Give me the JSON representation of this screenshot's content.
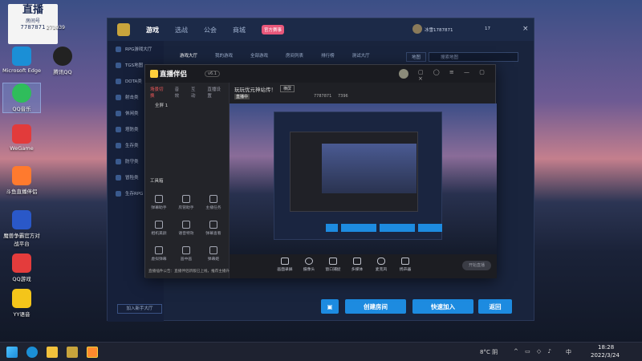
{
  "desktop": {
    "watermark": {
      "title": "直播",
      "sub": "房间号",
      "room": "7787871",
      "extra": "271039"
    },
    "icons": [
      {
        "label": "Microsoft Edge",
        "color": "#1b8fd6",
        "glyph": "e"
      },
      {
        "label": "腾讯QQ",
        "color": "#222",
        "glyph": "Q"
      },
      {
        "label": "QQ音乐",
        "color": "#2fbd5b",
        "glyph": "♪"
      },
      {
        "label": "WeGame",
        "color": "#e23b3b",
        "glyph": "W"
      },
      {
        "label": "斗鱼直播伴侣",
        "color": "#ff7a2e",
        "glyph": "鱼"
      },
      {
        "label": "魔兽争霸官方对战平台",
        "color": "#2a58c8",
        "glyph": "W"
      },
      {
        "label": "QQ游戏",
        "color": "#e43c3c",
        "glyph": "Q"
      },
      {
        "label": "YY语音",
        "color": "#f4c51a",
        "glyph": "YY"
      }
    ]
  },
  "lobby": {
    "nav": [
      "游戏",
      "选战",
      "公会",
      "商城"
    ],
    "badge": "官方赛事",
    "user": "冰雪1787871",
    "level": "17",
    "tabs": [
      "游戏大厅",
      "我的游戏",
      "全部游戏",
      "房间列表",
      "排行榜",
      "测试大厅"
    ],
    "region": "地图",
    "search_placeholder": "搜索地图",
    "sidebar": [
      "RPG游戏大厅",
      "TGS地图",
      "DOTA类",
      "射击类",
      "休闲类",
      "塔防类",
      "生存类",
      "防守类",
      "冒险类",
      "生存RPG"
    ],
    "join_game": "加入新手大厅",
    "create_room": "创建房间",
    "quick_join": "快速加入",
    "back": "返回"
  },
  "stream": {
    "app_title": "直播伴侣",
    "version": "v6.1",
    "title_line": "玩玩优元神站传！",
    "tag": "横屏",
    "room_label": "直播中",
    "room_id": "7787871",
    "viewers": "7396",
    "left_tabs": [
      "场景切换",
      "音效",
      "互动",
      "直播设置"
    ],
    "scene_item": "全屏 1",
    "toolbox_title": "工具箱",
    "tools": [
      "弹幕助手",
      "房管助手",
      "主播任务",
      "相机美颜",
      "语音特效",
      "弹幕查看",
      "虚拟弹幕",
      "画中画",
      "弹幕姬"
    ],
    "footer_note": "直播插件公告：直播伴侣新版已上线，推荐主播升级体验",
    "bottom": [
      "画面录屏",
      "摄像头",
      "窗口捕捉",
      "多媒体",
      "麦克风",
      "扬声器"
    ],
    "start_btn": "开始直播"
  },
  "taskbar": {
    "weather": "8°C 阴",
    "time": "18:28",
    "date": "2022/3/24",
    "ime": "中"
  }
}
